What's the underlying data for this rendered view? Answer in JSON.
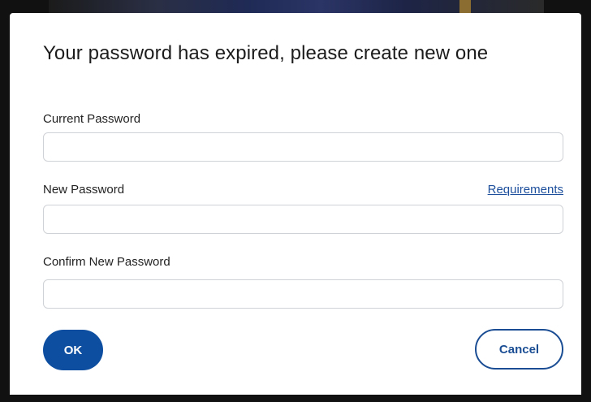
{
  "dialog": {
    "title": "Your password has expired, please create new one",
    "requirements_link": "Requirements",
    "fields": [
      {
        "label": "Current Password",
        "value": "",
        "placeholder": ""
      },
      {
        "label": "New Password",
        "value": "",
        "placeholder": ""
      },
      {
        "label": "Confirm New Password",
        "value": "",
        "placeholder": ""
      }
    ],
    "ok_label": "OK",
    "cancel_label": "Cancel"
  },
  "colors": {
    "primary": "#0d4ea1",
    "link": "#1d4f9c",
    "backdrop": "#121212"
  }
}
